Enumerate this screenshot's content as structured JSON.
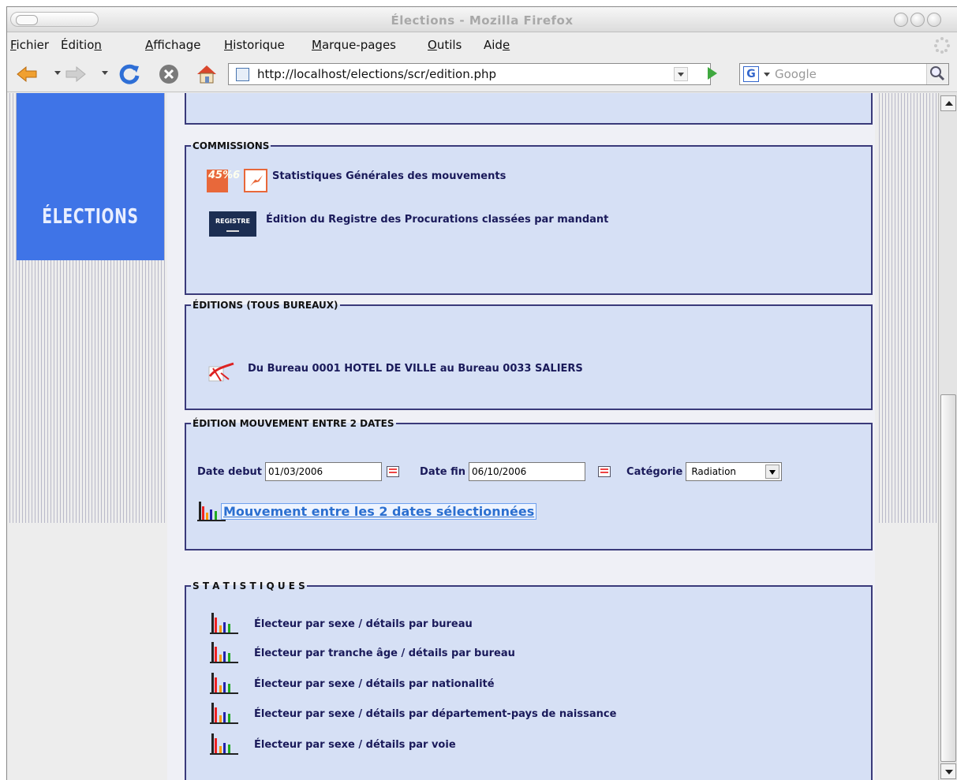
{
  "window": {
    "title": "Élections - Mozilla Firefox"
  },
  "menu": {
    "items": [
      {
        "accel": "F",
        "rest": "ichier"
      },
      {
        "pre": "Éditio",
        "accel": "n",
        "rest": ""
      },
      {
        "accel": "A",
        "rest": "ffichage"
      },
      {
        "accel": "H",
        "rest": "istorique"
      },
      {
        "accel": "M",
        "rest": "arque-pages"
      },
      {
        "accel": "O",
        "rest": "utils"
      },
      {
        "pre": "Aid",
        "accel": "e",
        "rest": ""
      }
    ]
  },
  "navigation": {
    "url": "http://localhost/elections/scr/edition.php",
    "search_placeholder": "Google",
    "search_engine_letter": "G"
  },
  "sidebar": {
    "logo_text": "ÉLECTIONS"
  },
  "commissions": {
    "legend": "COMMISSIONS",
    "pct_icon_text": "45%6",
    "stats_label": "Statistiques Générales des mouvements",
    "registre_icon_text": "REGISTRE",
    "registre_label": "Édition du Registre des Procurations classées par mandant"
  },
  "editions": {
    "legend": "ÉDITIONS (TOUS BUREAUX)",
    "label": "Du Bureau 0001 HOTEL DE VILLE au Bureau 0033 SALIERS"
  },
  "mouvement": {
    "legend": "ÉDITION MOUVEMENT ENTRE 2 DATES",
    "date_debut_label": "Date debut",
    "date_debut_value": "01/03/2006",
    "date_fin_label": "Date fin",
    "date_fin_value": "06/10/2006",
    "categorie_label": "Catégorie",
    "categorie_value": "Radiation",
    "link_label": "Mouvement entre les 2 dates sélectionnées"
  },
  "statistiques": {
    "legend": "S T A T I S T I Q U E S",
    "items": [
      "Électeur par sexe / détails par bureau",
      "Électeur par tranche âge / détails par bureau",
      "Électeur par sexe / détails par nationalité",
      "Électeur par sexe / détails par département-pays de naissance",
      "Électeur par sexe / détails par voie"
    ]
  }
}
